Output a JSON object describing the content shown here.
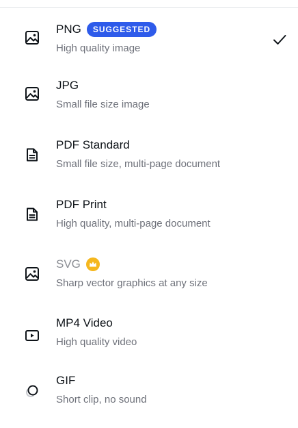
{
  "options": [
    {
      "title": "PNG",
      "badge": "SUGGESTED",
      "description": "High quality image",
      "icon": "image-icon",
      "selected": true
    },
    {
      "title": "JPG",
      "description": "Small file size image",
      "icon": "image-icon"
    },
    {
      "title": "PDF Standard",
      "description": "Small file size, multi-page document",
      "icon": "document-icon"
    },
    {
      "title": "PDF Print",
      "description": "High quality, multi-page document",
      "icon": "document-icon"
    },
    {
      "title": "SVG",
      "description": "Sharp vector graphics at any size",
      "icon": "image-icon",
      "premium": true,
      "premium_icon": "crown-icon"
    },
    {
      "title": "MP4 Video",
      "description": "High quality video",
      "icon": "video-play-icon"
    },
    {
      "title": "GIF",
      "description": "Short clip, no sound",
      "icon": "gif-loop-icon"
    }
  ],
  "selected_icon": "checkmark-icon",
  "colors": {
    "badge_bg": "#2e5bea",
    "crown": "#f5b71e",
    "text_primary": "#0e1318",
    "text_secondary": "#6d7079",
    "text_disabled": "#8a8d93"
  }
}
